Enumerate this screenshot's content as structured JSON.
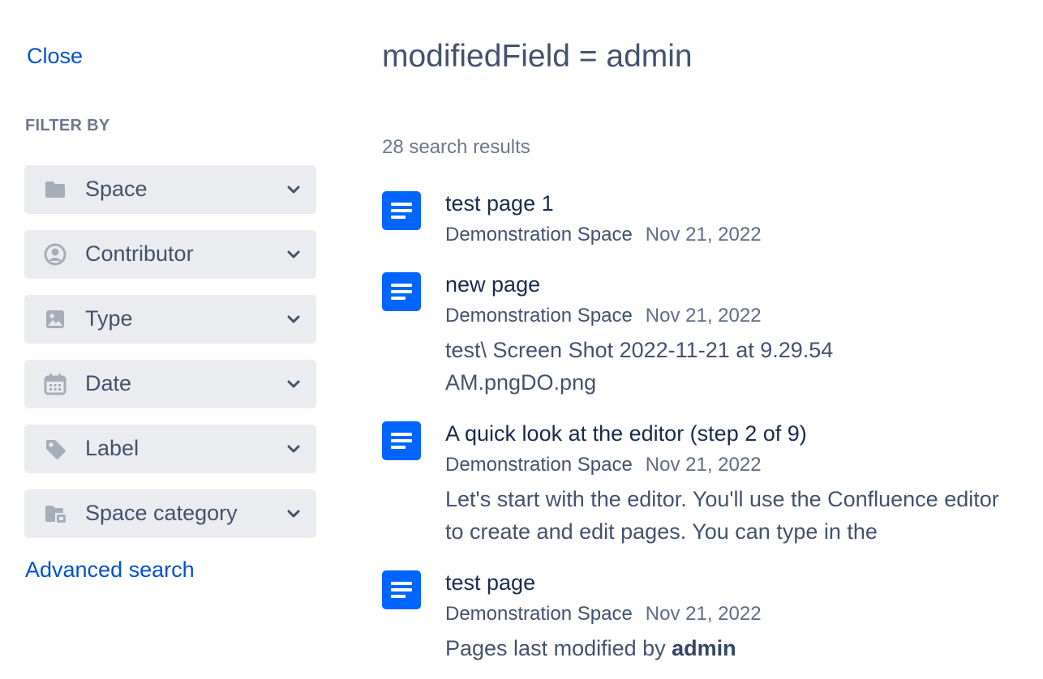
{
  "sidebar": {
    "close_label": "Close",
    "filter_heading": "FILTER BY",
    "filters": [
      {
        "label": "Space",
        "icon": "folder-icon"
      },
      {
        "label": "Contributor",
        "icon": "person-circle-icon"
      },
      {
        "label": "Type",
        "icon": "image-icon"
      },
      {
        "label": "Date",
        "icon": "calendar-icon"
      },
      {
        "label": "Label",
        "icon": "tag-icon"
      },
      {
        "label": "Space category",
        "icon": "folder-category-icon"
      }
    ],
    "advanced_search_label": "Advanced search"
  },
  "main": {
    "query": "modifiedField = admin",
    "results_count": "28 search results",
    "results": [
      {
        "title": "test page 1",
        "space": "Demonstration Space",
        "date": "Nov 21, 2022",
        "excerpt": ""
      },
      {
        "title": "new page",
        "space": "Demonstration Space",
        "date": "Nov 21, 2022",
        "excerpt": "test\\ Screen Shot 2022-11-21 at 9.29.54 AM.pngDO.png"
      },
      {
        "title": "A quick look at the editor (step 2 of 9)",
        "space": "Demonstration Space",
        "date": "Nov 21, 2022",
        "excerpt": "Let's start with the editor. You'll use the Confluence editor to create and edit pages. You can type in the"
      },
      {
        "title": "test page",
        "space": "Demonstration Space",
        "date": "Nov 21, 2022",
        "excerpt_prefix": "Pages last modified by ",
        "excerpt_bold": "admin"
      }
    ]
  },
  "colors": {
    "link": "#0052cc",
    "doc_icon": "#0065ff",
    "filter_bg": "#ebecf0",
    "muted_text": "#6b778c"
  }
}
